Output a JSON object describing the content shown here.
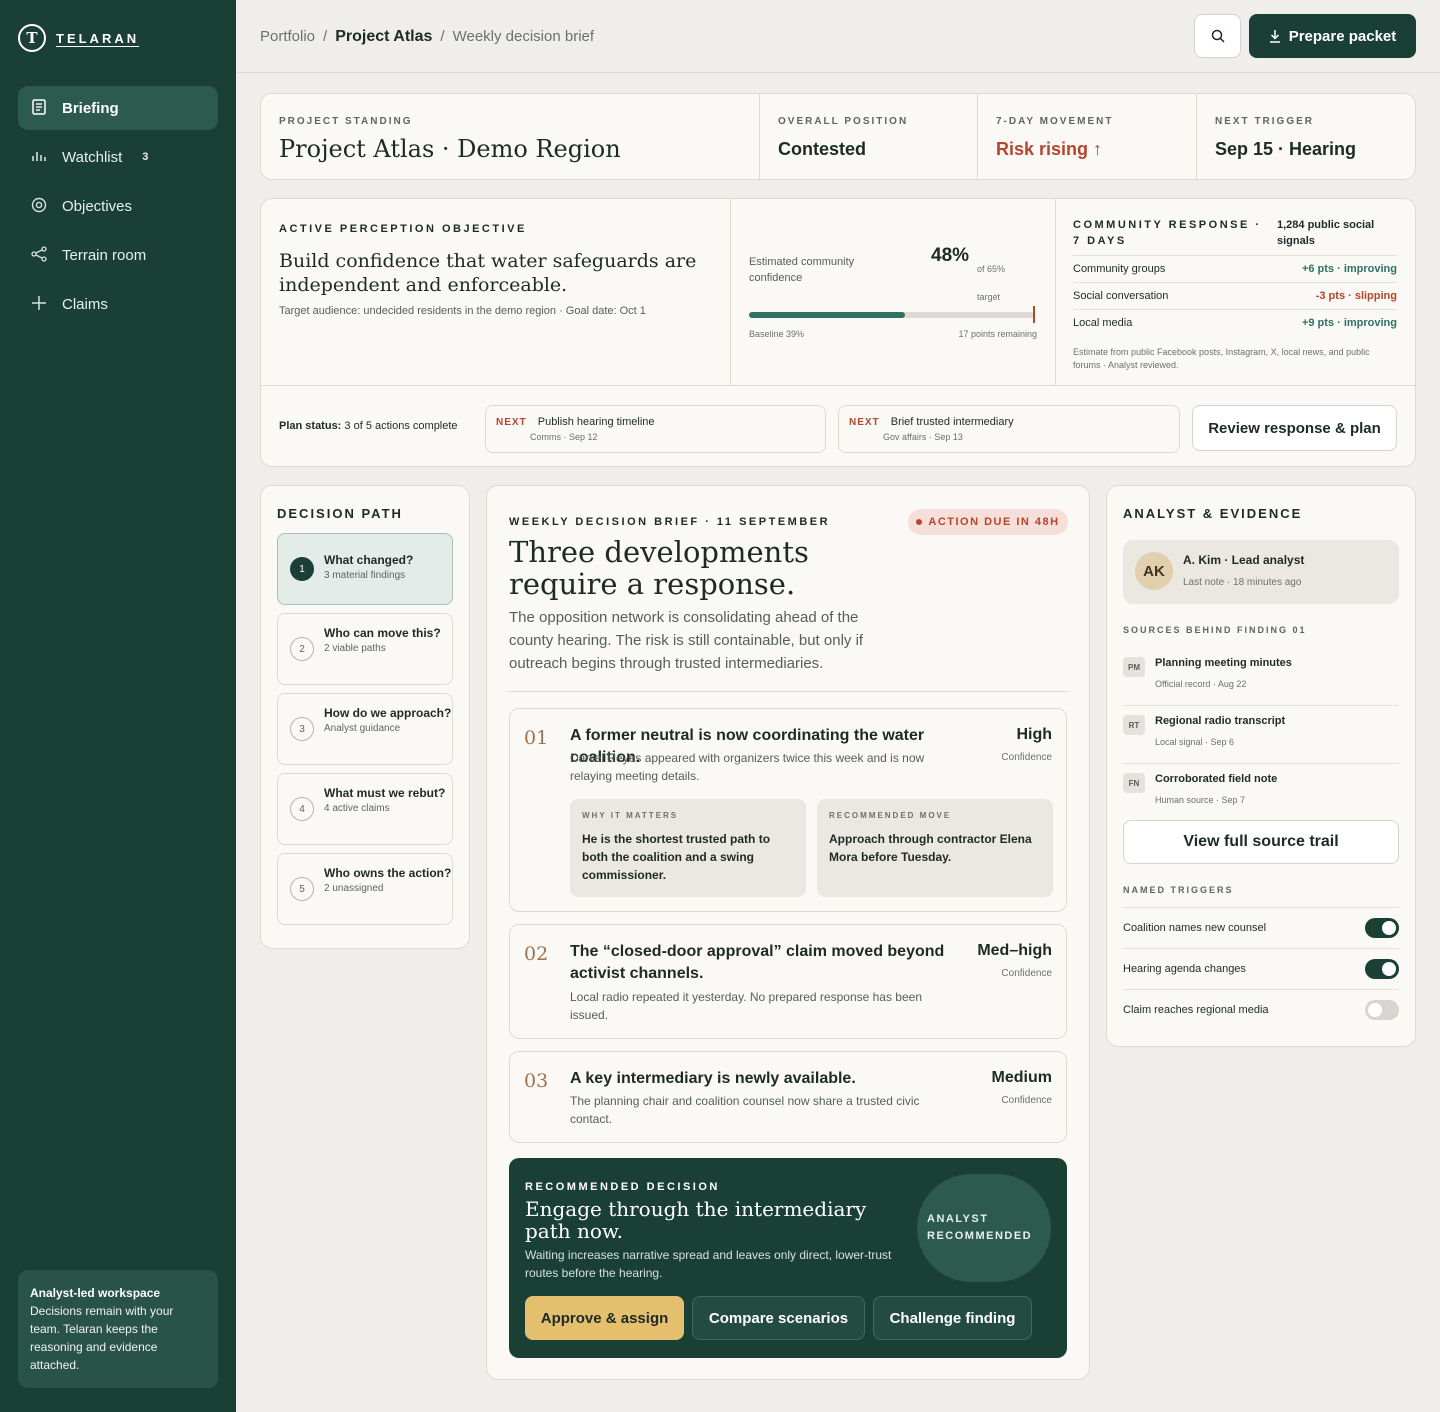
{
  "brand": {
    "logo_letter": "T",
    "name": "TELARAN"
  },
  "nav": [
    {
      "label": "Briefing",
      "icon": "document-icon",
      "active": true
    },
    {
      "label": "Watchlist",
      "icon": "bars-icon",
      "count": "3"
    },
    {
      "label": "Objectives",
      "icon": "target-icon"
    },
    {
      "label": "Terrain room",
      "icon": "share-icon"
    },
    {
      "label": "Claims",
      "icon": "plus-icon"
    }
  ],
  "side_note": {
    "title": "Analyst-led workspace",
    "body": "Decisions remain with your team. Telaran keeps the reasoning and evidence attached."
  },
  "breadcrumb": {
    "root": "Portfolio",
    "project": "Project Atlas",
    "page": "Weekly decision brief"
  },
  "header": {
    "prepare_label": "Prepare packet"
  },
  "standing": {
    "project": {
      "label": "Project standing",
      "value": "Project Atlas · Demo Region"
    },
    "position": {
      "label": "Overall position",
      "value": "Contested"
    },
    "movement": {
      "label": "7-day movement",
      "value": "Risk rising ↑"
    },
    "trigger": {
      "label": "Next trigger",
      "value": "Sep 15 · Hearing"
    }
  },
  "objective": {
    "label": "Active perception objective",
    "title": "Build confidence that water safeguards are independent and enforceable.",
    "meta": "Target audience: undecided residents in the demo region · Goal date: Oct 1",
    "metric_label": "Estimated community confidence",
    "metric_value": "48%",
    "metric_target": "of 65% target",
    "progress": 0.48,
    "target": 0.65,
    "baseline": "Baseline 39%",
    "remaining": "17 points remaining"
  },
  "response": {
    "label": "Community response · 7 days",
    "count": "1,284 public social signals",
    "rows": [
      {
        "name": "Community groups",
        "value": "+6 pts · improving",
        "trend": "pos"
      },
      {
        "name": "Social conversation",
        "value": "-3 pts · slipping",
        "trend": "neg"
      },
      {
        "name": "Local media",
        "value": "+9 pts · improving",
        "trend": "pos"
      }
    ],
    "note": "Estimate from public Facebook posts, Instagram, X, local news, and public forums · Analyst reviewed."
  },
  "plan": {
    "status_label": "Plan status:",
    "status_value": "3 of 5 actions complete",
    "next1": {
      "tag": "NEXT",
      "title": "Publish hearing timeline",
      "sub": "Comms · Sep 12"
    },
    "next2": {
      "tag": "NEXT",
      "title": "Brief trusted intermediary",
      "sub": "Gov affairs · Sep 13"
    },
    "review_label": "Review response & plan"
  },
  "decision_path": {
    "label": "Decision path",
    "steps": [
      {
        "num": "1",
        "title": "What changed?",
        "sub": "3 material findings"
      },
      {
        "num": "2",
        "title": "Who can move this?",
        "sub": "2 viable paths"
      },
      {
        "num": "3",
        "title": "How do we approach?",
        "sub": "Analyst guidance"
      },
      {
        "num": "4",
        "title": "What must we rebut?",
        "sub": "4 active claims"
      },
      {
        "num": "5",
        "title": "Who owns the action?",
        "sub": "2 unassigned"
      }
    ]
  },
  "brief": {
    "label": "Weekly decision brief · 11 September",
    "due": "ACTION DUE IN 48H",
    "title": "Three developments require a response.",
    "lede": "The opposition network is consolidating ahead of the county hearing. The risk is still containable, but only if outreach begins through trusted intermediaries.",
    "findings": [
      {
        "num": "01",
        "title": "A former neutral is now coordinating the water coalition.",
        "desc": "Daniel Reyes appeared with organizers twice this week and is now relaying meeting details.",
        "confidence": "High",
        "conf_label": "Confidence"
      },
      {
        "num": "02",
        "title": "The “closed-door approval” claim moved beyond activist channels.",
        "desc": "Local radio repeated it yesterday. No prepared response has been issued.",
        "confidence": "Med–high",
        "conf_label": "Confidence"
      },
      {
        "num": "03",
        "title": "A key intermediary is newly available.",
        "desc": "The planning chair and coalition counsel now share a trusted civic contact.",
        "confidence": "Medium",
        "conf_label": "Confidence"
      }
    ],
    "why": {
      "label": "Why it matters",
      "text": "He is the shortest trusted path to both the coalition and a swing commissioner."
    },
    "move": {
      "label": "Recommended move",
      "text": "Approach through contractor Elena Mora before Tuesday."
    },
    "recommendation": {
      "label": "Recommended decision",
      "title": "Engage through the intermediary path now.",
      "desc": "Waiting increases narrative spread and leaves only direct, lower-trust routes before the hearing.",
      "badge1": "ANALYST",
      "badge2": "RECOMMENDED",
      "approve": "Approve & assign",
      "compare": "Compare scenarios",
      "challenge": "Challenge finding"
    }
  },
  "analyst": {
    "label": "Analyst & evidence",
    "initials": "AK",
    "name": "A. Kim · Lead analyst",
    "last_note": "Last note · 18 minutes ago",
    "sources_label": "Sources behind finding 01",
    "sources": [
      {
        "tag": "PM",
        "title": "Planning meeting minutes",
        "sub": "Official record · Aug 22"
      },
      {
        "tag": "RT",
        "title": "Regional radio transcript",
        "sub": "Local signal · Sep 6"
      },
      {
        "tag": "FN",
        "title": "Corroborated field note",
        "sub": "Human source · Sep 7"
      }
    ],
    "trail_label": "View full source trail",
    "triggers_label": "Named triggers",
    "triggers": [
      {
        "label": "Coalition names new counsel",
        "on": true
      },
      {
        "label": "Hearing agenda changes",
        "on": true
      },
      {
        "label": "Claim reaches regional media",
        "on": false
      }
    ]
  },
  "colors": {
    "sidebar": "#1a4036",
    "accent_red": "#b3462b",
    "accent_green": "#2f7262",
    "approve": "#e4bf6e"
  }
}
